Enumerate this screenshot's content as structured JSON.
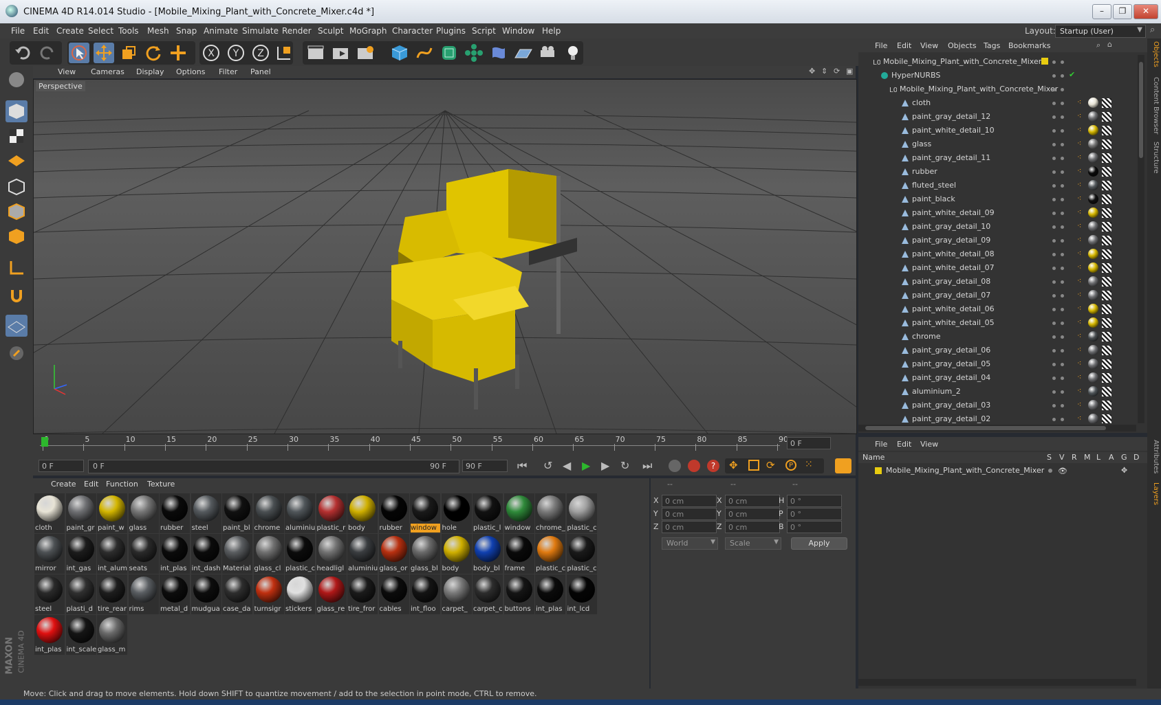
{
  "window": {
    "title": "CINEMA 4D R14.014 Studio - [Mobile_Mixing_Plant_with_Concrete_Mixer.c4d *]"
  },
  "menubar": {
    "items": [
      "File",
      "Edit",
      "Create",
      "Select",
      "Tools",
      "Mesh",
      "Snap",
      "Animate",
      "Simulate",
      "Render",
      "Sculpt",
      "MoGraph",
      "Character",
      "Plugins",
      "Script",
      "Window",
      "Help"
    ],
    "layout_label": "Layout:",
    "layout_value": "Startup (User)"
  },
  "viewport": {
    "menu": [
      "View",
      "Cameras",
      "Display",
      "Options",
      "Filter",
      "Panel"
    ],
    "camera_label": "Perspective"
  },
  "timeline": {
    "ticks": [
      "0",
      "5",
      "10",
      "15",
      "20",
      "25",
      "30",
      "35",
      "40",
      "45",
      "50",
      "55",
      "60",
      "65",
      "70",
      "75",
      "80",
      "85",
      "90"
    ],
    "current_frame": "0 F",
    "start_field": "0 F",
    "range_start": "0 F",
    "range_end": "90 F",
    "end_field": "90 F"
  },
  "materials": {
    "menu": [
      "Create",
      "Edit",
      "Function",
      "Texture"
    ],
    "items": [
      {
        "label": "cloth",
        "color": "#e8e4d6"
      },
      {
        "label": "paint_gr",
        "color": "#6f7073"
      },
      {
        "label": "paint_w",
        "color": "#d4b600"
      },
      {
        "label": "glass",
        "color": "#777777"
      },
      {
        "label": "rubber",
        "color": "#0a0a0a"
      },
      {
        "label": "steel",
        "color": "#555a5e"
      },
      {
        "label": "paint_bl",
        "color": "#111111"
      },
      {
        "label": "chrome",
        "color": "#4a4f52"
      },
      {
        "label": "aluminiu",
        "color": "#50565a"
      },
      {
        "label": "plastic_r",
        "color": "#b53030"
      },
      {
        "label": "body",
        "color": "#d0b000"
      },
      {
        "label": "rubber",
        "color": "#050505"
      },
      {
        "label": "window",
        "color": "#1a1a1a",
        "highlight": true
      },
      {
        "label": "hole",
        "color": "#000000"
      },
      {
        "label": "plastic_l",
        "color": "#121212"
      },
      {
        "label": "window",
        "color": "#2f8a3a"
      },
      {
        "label": "chrome_",
        "color": "#7a7a7a"
      },
      {
        "label": "plastic_c",
        "color": "#a0a0a0"
      },
      {
        "label": "mirror",
        "color": "#4d5154"
      },
      {
        "label": "int_gas",
        "color": "#1c1c1c"
      },
      {
        "label": "int_alum",
        "color": "#2d2d2d"
      },
      {
        "label": "seats",
        "color": "#2a2a2a"
      },
      {
        "label": "int_plas",
        "color": "#0b0b0b"
      },
      {
        "label": "int_dash",
        "color": "#0b0b0b"
      },
      {
        "label": "Material",
        "color": "#5a5d60"
      },
      {
        "label": "glass_cl",
        "color": "#707070"
      },
      {
        "label": "plastic_c",
        "color": "#0c0c0c"
      },
      {
        "label": "headligl",
        "color": "#727272"
      },
      {
        "label": "aluminiu",
        "color": "#3a3d40"
      },
      {
        "label": "glass_or",
        "color": "#b83010"
      },
      {
        "label": "glass_bl",
        "color": "#6a6a6a"
      },
      {
        "label": "body",
        "color": "#d0b000"
      },
      {
        "label": "body_bl",
        "color": "#1040b0"
      },
      {
        "label": "frame",
        "color": "#0a0a0a"
      },
      {
        "label": "plastic_c",
        "color": "#e07a10"
      },
      {
        "label": "plastic_c",
        "color": "#1a1a1a"
      },
      {
        "label": "steel",
        "color": "#2a2a2a"
      },
      {
        "label": "plasti_d",
        "color": "#303030"
      },
      {
        "label": "tire_rear",
        "color": "#1e1e1e"
      },
      {
        "label": "rims",
        "color": "#5a5e62"
      },
      {
        "label": "metal_d",
        "color": "#0d0d0d"
      },
      {
        "label": "mudgua",
        "color": "#0d0d0d"
      },
      {
        "label": "case_da",
        "color": "#2e2e2e"
      },
      {
        "label": "turnsigr",
        "color": "#c03010"
      },
      {
        "label": "stickers",
        "color": "#e0e0e0"
      },
      {
        "label": "glass_re",
        "color": "#b01818"
      },
      {
        "label": "tire_fror",
        "color": "#1b1b1b"
      },
      {
        "label": "cables",
        "color": "#0c0c0c"
      },
      {
        "label": "int_floo",
        "color": "#141414"
      },
      {
        "label": "carpet_",
        "color": "#7a7a7a"
      },
      {
        "label": "carpet_c",
        "color": "#2d2d2d"
      },
      {
        "label": "buttons",
        "color": "#151515"
      },
      {
        "label": "int_plas",
        "color": "#0b0b0b"
      },
      {
        "label": "int_lcd",
        "color": "#050505"
      },
      {
        "label": "int_plas",
        "color": "#e01010"
      },
      {
        "label": "int_scale",
        "color": "#151515"
      },
      {
        "label": "glass_m",
        "color": "#6a6a6a"
      }
    ]
  },
  "coords": {
    "headers": [
      "--",
      "--",
      "--"
    ],
    "rows": [
      {
        "a": "X",
        "av": "0 cm",
        "b": "X",
        "bv": "0 cm",
        "c": "H",
        "cv": "0 °"
      },
      {
        "a": "Y",
        "av": "0 cm",
        "b": "Y",
        "bv": "0 cm",
        "c": "P",
        "cv": "0 °"
      },
      {
        "a": "Z",
        "av": "0 cm",
        "b": "Z",
        "bv": "0 cm",
        "c": "B",
        "cv": "0 °"
      }
    ],
    "mode": "World",
    "transform": "Scale",
    "apply": "Apply"
  },
  "objects": {
    "menu": [
      "File",
      "Edit",
      "View",
      "Objects",
      "Tags",
      "Bookmarks"
    ],
    "root": "Mobile_Mixing_Plant_with_Concrete_Mixer",
    "hypernurbs": "HyperNURBS",
    "group": "Mobile_Mixing_Plant_with_Concrete_Mixer",
    "children": [
      {
        "name": "cloth",
        "mat": "#e8e4d6"
      },
      {
        "name": "paint_gray_detail_12",
        "mat": "#6f7073"
      },
      {
        "name": "paint_white_detail_10",
        "mat": "#d4b600"
      },
      {
        "name": "glass",
        "mat": "#777777"
      },
      {
        "name": "paint_gray_detail_11",
        "mat": "#6f7073"
      },
      {
        "name": "rubber",
        "mat": "#0a0a0a"
      },
      {
        "name": "fluted_steel",
        "mat": "#555a5e"
      },
      {
        "name": "paint_black",
        "mat": "#111111"
      },
      {
        "name": "paint_white_detail_09",
        "mat": "#d4b600"
      },
      {
        "name": "paint_gray_detail_10",
        "mat": "#6f7073"
      },
      {
        "name": "paint_gray_detail_09",
        "mat": "#6f7073"
      },
      {
        "name": "paint_white_detail_08",
        "mat": "#d4b600"
      },
      {
        "name": "paint_white_detail_07",
        "mat": "#d4b600"
      },
      {
        "name": "paint_gray_detail_08",
        "mat": "#6f7073"
      },
      {
        "name": "paint_gray_detail_07",
        "mat": "#6f7073"
      },
      {
        "name": "paint_white_detail_06",
        "mat": "#d4b600"
      },
      {
        "name": "paint_white_detail_05",
        "mat": "#d4b600"
      },
      {
        "name": "chrome",
        "mat": "#4a4f52"
      },
      {
        "name": "paint_gray_detail_06",
        "mat": "#6f7073"
      },
      {
        "name": "paint_gray_detail_05",
        "mat": "#6f7073"
      },
      {
        "name": "paint_gray_detail_04",
        "mat": "#6f7073"
      },
      {
        "name": "aluminium_2",
        "mat": "#50565a"
      },
      {
        "name": "paint_gray_detail_03",
        "mat": "#6f7073"
      },
      {
        "name": "paint_gray_detail_02",
        "mat": "#6f7073"
      }
    ]
  },
  "layers": {
    "menu": [
      "File",
      "Edit",
      "View"
    ],
    "columns": [
      "Name",
      "S",
      "V",
      "R",
      "M",
      "L",
      "A",
      "G",
      "D"
    ],
    "row": "Mobile_Mixing_Plant_with_Concrete_Mixer"
  },
  "right_tabs": [
    "Objects",
    "Content Browser",
    "Structure",
    "Attributes",
    "Layers"
  ],
  "branding": {
    "line1": "MAXON",
    "line2": "CINEMA 4D"
  },
  "status": "Move: Click and drag to move elements. Hold down SHIFT to quantize movement / add to the selection in point mode, CTRL to remove.",
  "colors": {
    "accent": "#f0a020",
    "selected": "#5a7ca8",
    "yellow": "#e8cc10"
  }
}
